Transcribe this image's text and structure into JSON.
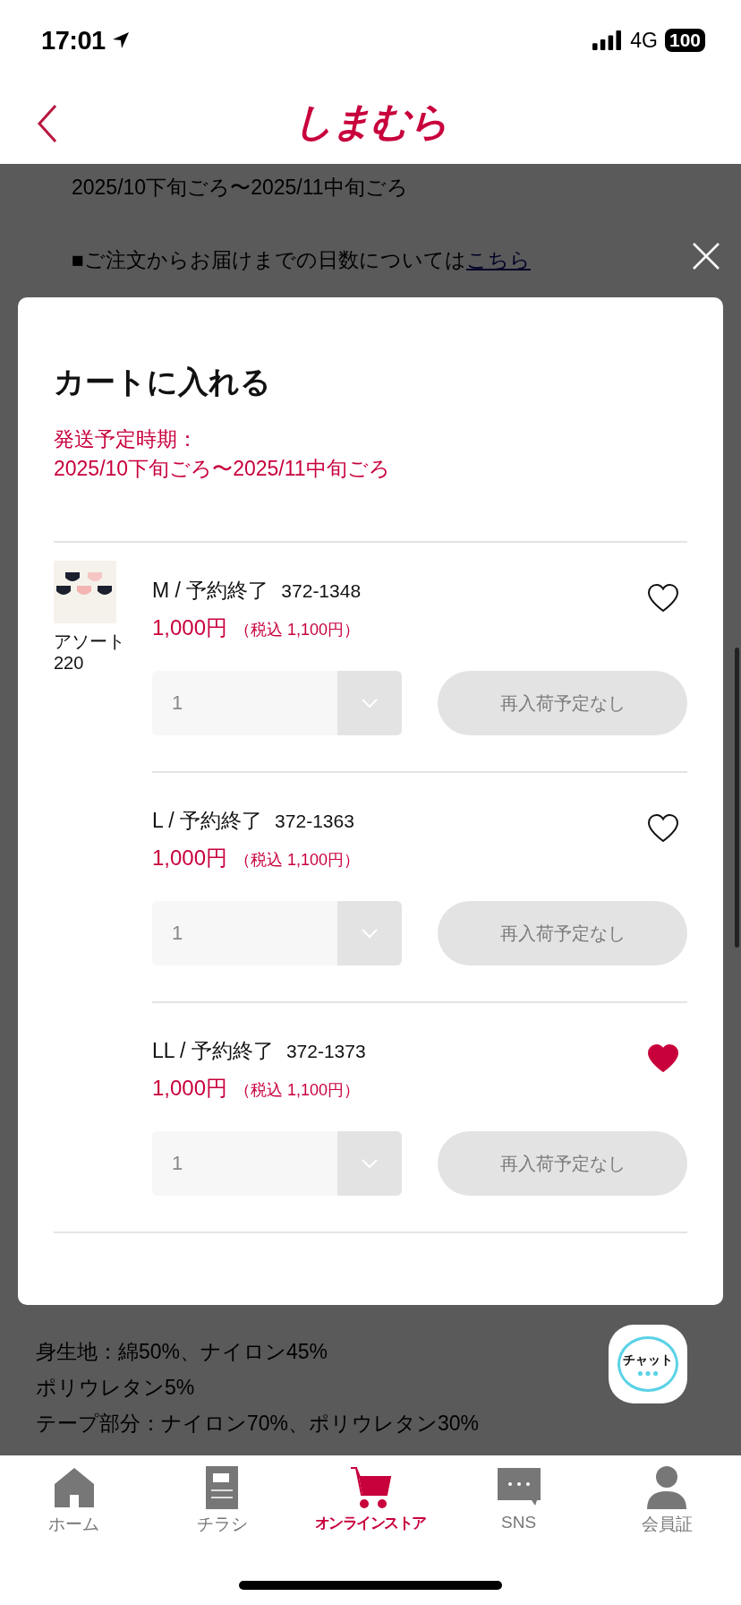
{
  "status_bar": {
    "time": "17:01",
    "network": "4G",
    "battery": "100"
  },
  "header": {
    "logo": "しまむら"
  },
  "background_page": {
    "top_lines": [
      {
        "text": "2025/10下旬ごろ〜2025/11中旬ごろ"
      },
      {
        "text": "■ご注文からお届けまでの日数については",
        "link": "こちら"
      }
    ],
    "bottom_lines": [
      "身生地：綿50%、ナイロン45%",
      "ポリウレタン5%",
      "テープ部分：ナイロン70%、ポリウレタン30%"
    ]
  },
  "modal": {
    "title": "カートに入れる",
    "shipping_label": "発送予定時期：",
    "shipping_period": "2025/10下旬ごろ〜2025/11中旬ごろ",
    "product": {
      "kind": "picture",
      "color_name": "アソート",
      "color_code": "220"
    },
    "variants": [
      {
        "name": "M / 予約終了",
        "code": "372-1348",
        "price": "1,000円",
        "tax_price": "（税込 1,100円）",
        "favorite": false,
        "quantity": "1",
        "quantity_disabled": true,
        "button": "再入荷予定なし",
        "button_disabled": true
      },
      {
        "name": "L / 予約終了",
        "code": "372-1363",
        "price": "1,000円",
        "tax_price": "（税込 1,100円）",
        "favorite": false,
        "quantity": "1",
        "quantity_disabled": true,
        "button": "再入荷予定なし",
        "button_disabled": true
      },
      {
        "name": "LL / 予約終了",
        "code": "372-1373",
        "price": "1,000円",
        "tax_price": "（税込 1,100円）",
        "favorite": true,
        "quantity": "1",
        "quantity_disabled": true,
        "button": "再入荷予定なし",
        "button_disabled": true
      }
    ]
  },
  "chat_button": {
    "label": "チャット"
  },
  "nav": [
    {
      "kind": "home",
      "label": "ホーム",
      "selected": false
    },
    {
      "kind": "flyer",
      "label": "チラシ",
      "selected": false
    },
    {
      "kind": "cart",
      "label": "オンラインストア",
      "selected": true
    },
    {
      "kind": "chat",
      "label": "SNS",
      "selected": false
    },
    {
      "kind": "member",
      "label": "会員証",
      "selected": false
    }
  ]
}
